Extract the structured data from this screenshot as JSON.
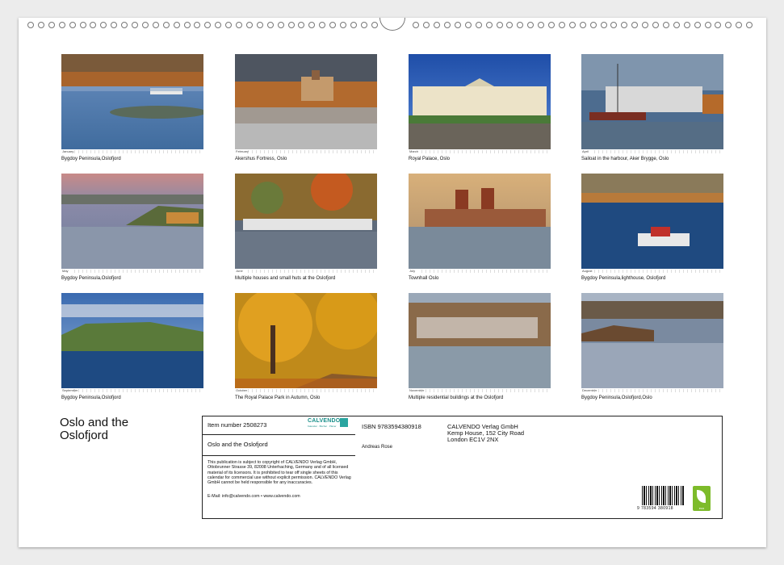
{
  "photos": [
    {
      "caption": "Bygdoy Peninsula,Oslofjord",
      "month": "January"
    },
    {
      "caption": "Akershus Fortress, Oslo",
      "month": "February"
    },
    {
      "caption": "Royal Palace, Oslo",
      "month": "March"
    },
    {
      "caption": "Sailoat in the harbour, Aker Brygge, Oslo",
      "month": "April"
    },
    {
      "caption": "Bygdoy Peninsula,Oslofjord",
      "month": "May"
    },
    {
      "caption": "Multiple houses and small huts at the Oslofjord",
      "month": "June"
    },
    {
      "caption": "Townhall Oslo",
      "month": "July"
    },
    {
      "caption": "Bygdoy Peninsula,lighthouse, Oslofjord",
      "month": "August"
    },
    {
      "caption": "Bygdoy Peninsula,Oslofjord",
      "month": "September"
    },
    {
      "caption": "The Royal Palace Park  in Autumn, Oslo",
      "month": "October"
    },
    {
      "caption": "Multiple residential buildings at the Oslofjord",
      "month": "November"
    },
    {
      "caption": "Bygdoy Peninsula,Oslofjord,Oslo",
      "month": "December"
    }
  ],
  "calendar_title_line1": "Oslo and the",
  "calendar_title_line2": "Oslofjord",
  "info": {
    "item_number": "Item number 2508273",
    "logo_text": "CALVENDO",
    "logo_sub": "Kalender · Bücher · Planer",
    "product_title": "Oslo and the Oslofjord",
    "legal": "This publication is subject to copyright of CALVENDO Verlag GmbH, Ottobrunner Strasse 39, 82008 Unterhaching, Germany and of all licensed material of its licensors. It is prohibited to tear off single sheets of this calendar for commercial use without explicit permission. CALVENDO Verlag GmbH cannot be held responsible for any inaccuracies.",
    "contact": "E-Mail: info@calvendo.com • www.calvendo.com",
    "isbn": "ISBN 9783594380918",
    "publisher_line1": "CALVENDO Verlag GmbH",
    "publisher_line2": "Kemp House, 152 City Road",
    "publisher_line3": "London EC1V 2NX",
    "author": "Andreas Rose",
    "barcode_number": "9 783594 380918",
    "eco_label": "eco"
  },
  "colors": {
    "accent": "#1a8f8a",
    "eco_green": "#7dbb2a"
  }
}
